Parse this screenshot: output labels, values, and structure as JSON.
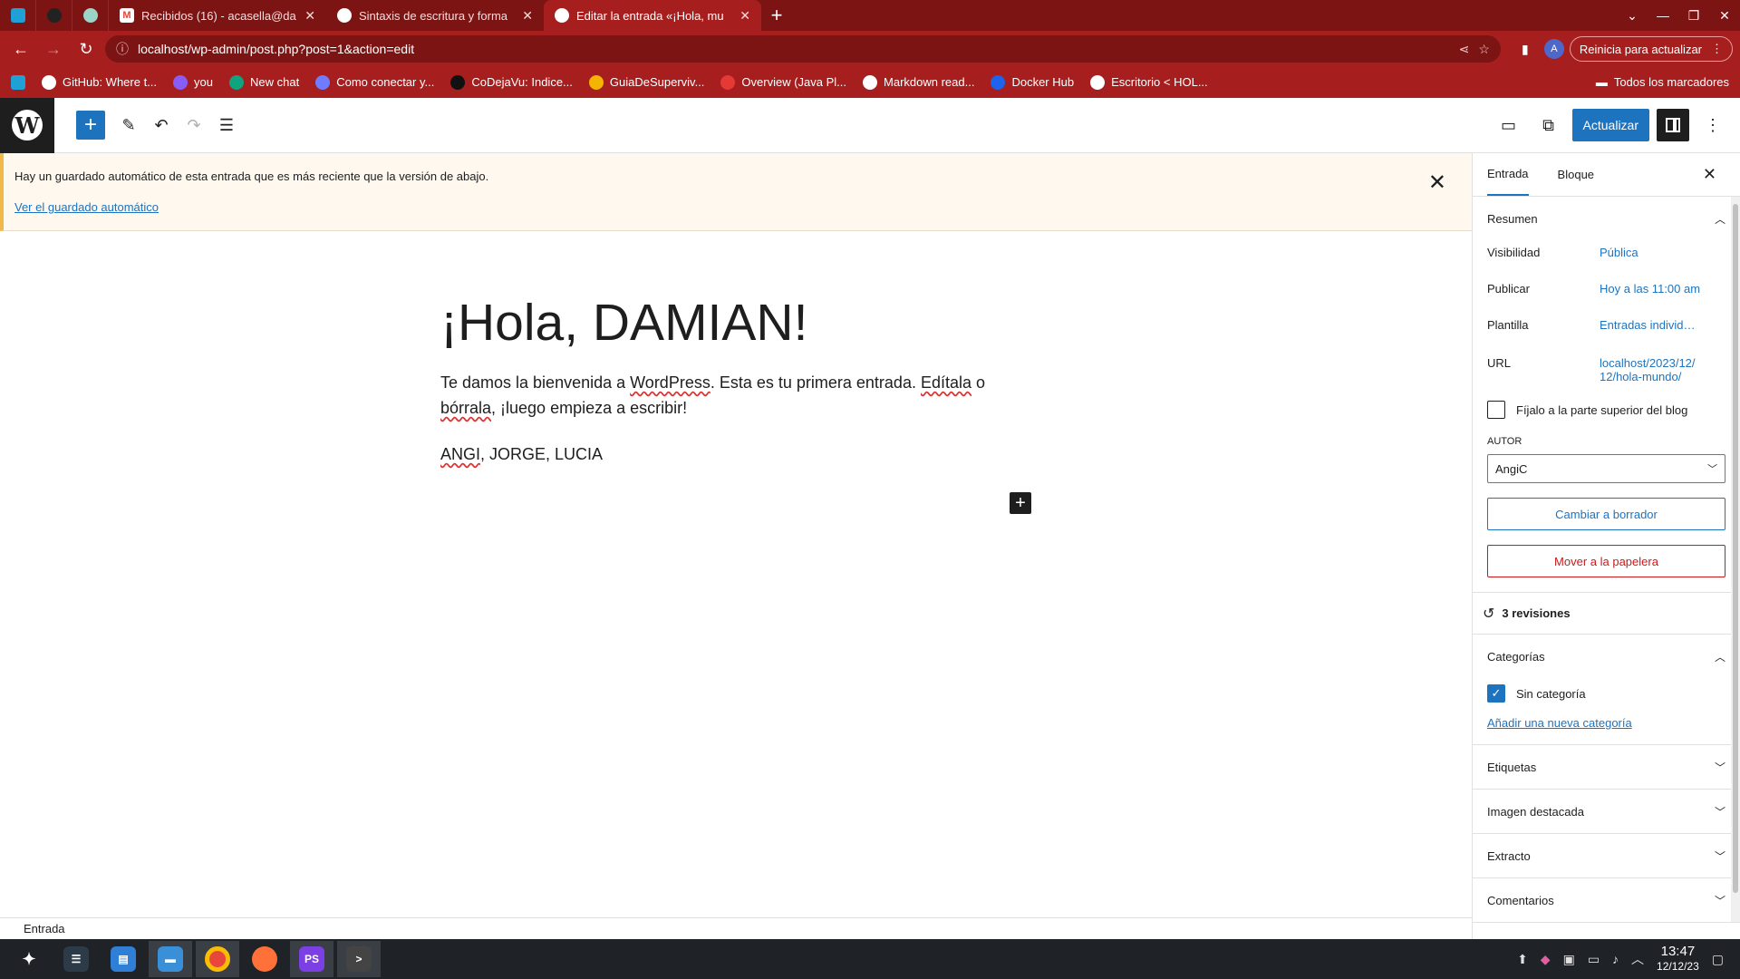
{
  "browser": {
    "tabs": [
      {
        "title": "Recibidos (16) - acasella@da",
        "favicon": "gmail-icon",
        "color": "#ea4335"
      },
      {
        "title": "Sintaxis de escritura y forma",
        "favicon": "github-icon",
        "color": "#ffffff"
      },
      {
        "title": "Editar la entrada «¡Hola, mu",
        "favicon": "wordpress-icon",
        "color": "#ffffff"
      }
    ],
    "url": "localhost/wp-admin/post.php?post=1&action=edit",
    "reinicia": "Reinicia para actualizar",
    "avatar": "A",
    "bookmarks": [
      {
        "label": "GitHub: Where t...",
        "color": "#ffffff"
      },
      {
        "label": "you",
        "color": "#8a5cf6"
      },
      {
        "label": "New chat",
        "color": "#10a37f"
      },
      {
        "label": "Como conectar y...",
        "color": "#6f7cff"
      },
      {
        "label": "CoDejaVu: Indice...",
        "color": "#111111"
      },
      {
        "label": "GuiaDeSuperviv...",
        "color": "#f4b400"
      },
      {
        "label": "Overview (Java Pl...",
        "color": "#e53935"
      },
      {
        "label": "Markdown read...",
        "color": "#ffffff"
      },
      {
        "label": "Docker Hub",
        "color": "#1d63ed"
      },
      {
        "label": "Escritorio < HOL...",
        "color": "#ffffff"
      }
    ],
    "bookmarks_all": "Todos los marcadores"
  },
  "toolbar": {
    "update_label": "Actualizar",
    "accent": "#1e73be"
  },
  "notice": {
    "text": "Hay un guardado automático de esta entrada que es más reciente que la versión de abajo.",
    "link": "Ver el guardado automático"
  },
  "post": {
    "title": "¡Hola, DAMIAN!",
    "paragraph_parts": [
      "Te damos la bienvenida a ",
      "WordPress",
      ". Esta es tu primera entrada. ",
      "Edítala",
      " o ",
      "bórrala",
      ", ¡luego empieza a escribir!"
    ],
    "names_parts": [
      "ANGI",
      ", JORGE, LUCIA"
    ]
  },
  "status": {
    "breadcrumb": "Entrada"
  },
  "sidebar": {
    "tabs": [
      "Entrada",
      "Bloque"
    ],
    "summary": {
      "title": "Resumen",
      "visibility_label": "Visibilidad",
      "visibility_value": "Pública",
      "publish_label": "Publicar",
      "publish_value": "Hoy a las 11:00 am",
      "template_label": "Plantilla",
      "template_value": "Entradas individ…",
      "url_label": "URL",
      "url_value": "localhost/2023/12/ 12/hola-mundo/",
      "sticky_label": "Fíjalo a la parte superior del blog",
      "author_label": "AUTOR",
      "author_value": "AngiC",
      "draft_button": "Cambiar a borrador",
      "trash_button": "Mover a la papelera"
    },
    "revisions": "3 revisiones",
    "categories": {
      "title": "Categorías",
      "item": "Sin categoría",
      "add_link": "Añadir una nueva categoría"
    },
    "tags": "Etiquetas",
    "featured_image": "Imagen destacada",
    "excerpt": "Extracto",
    "comments": "Comentarios"
  },
  "taskbar": {
    "time": "13:47",
    "date": "12/12/23"
  }
}
